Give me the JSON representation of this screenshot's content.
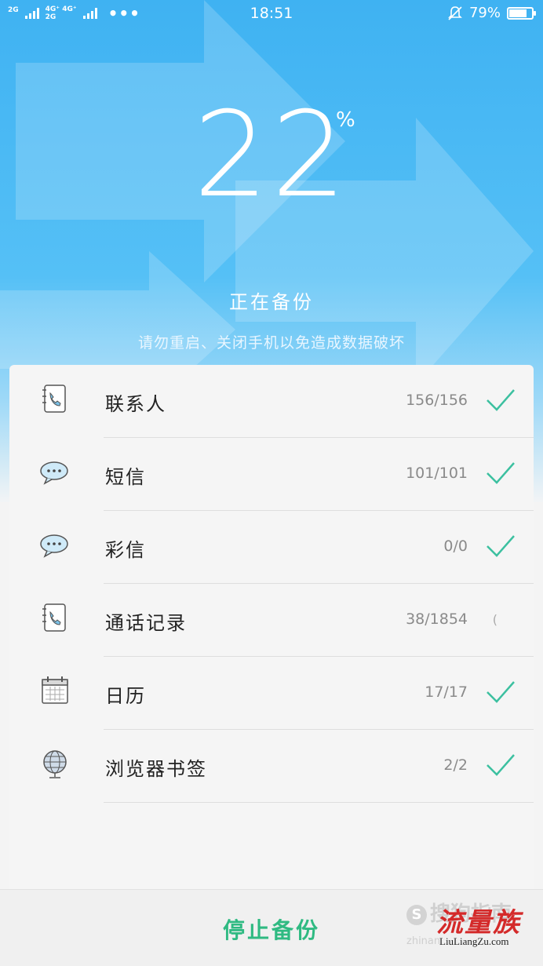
{
  "status_bar": {
    "net1": "2G",
    "net2_top": "4G⁺ 4G⁺",
    "net2_bottom": "2G",
    "more": "•••",
    "time": "18:51",
    "battery_text": "79%",
    "battery_level": 0.79,
    "mute_icon": "bell-off-icon"
  },
  "progress": {
    "value": "22",
    "unit": "%",
    "title": "正在备份",
    "subtitle": "请勿重启、关闭手机以免造成数据破坏"
  },
  "items": [
    {
      "label": "联系人",
      "count": "156/156",
      "icon": "contacts-book-icon",
      "done": true
    },
    {
      "label": "短信",
      "count": "101/101",
      "icon": "message-bubble-icon",
      "done": true
    },
    {
      "label": "彩信",
      "count": "0/0",
      "icon": "message-bubble-icon",
      "done": true
    },
    {
      "label": "通话记录",
      "count": "38/1854",
      "icon": "contacts-book-icon",
      "done": false
    },
    {
      "label": "日历",
      "count": "17/17",
      "icon": "calendar-icon",
      "done": true
    },
    {
      "label": "浏览器书签",
      "count": "2/2",
      "icon": "globe-icon",
      "done": true
    }
  ],
  "bottom": {
    "stop_label": "停止备份"
  },
  "watermark": {
    "brand1": "搜狗指南",
    "brand1_small": "zhinan",
    "brand2": "流量族",
    "brand2_url": "LiuLiangZu.com"
  },
  "colors": {
    "header_blue": "#3fb2f2",
    "accent_green": "#2fba82",
    "check_green": "#3cc0a0"
  }
}
